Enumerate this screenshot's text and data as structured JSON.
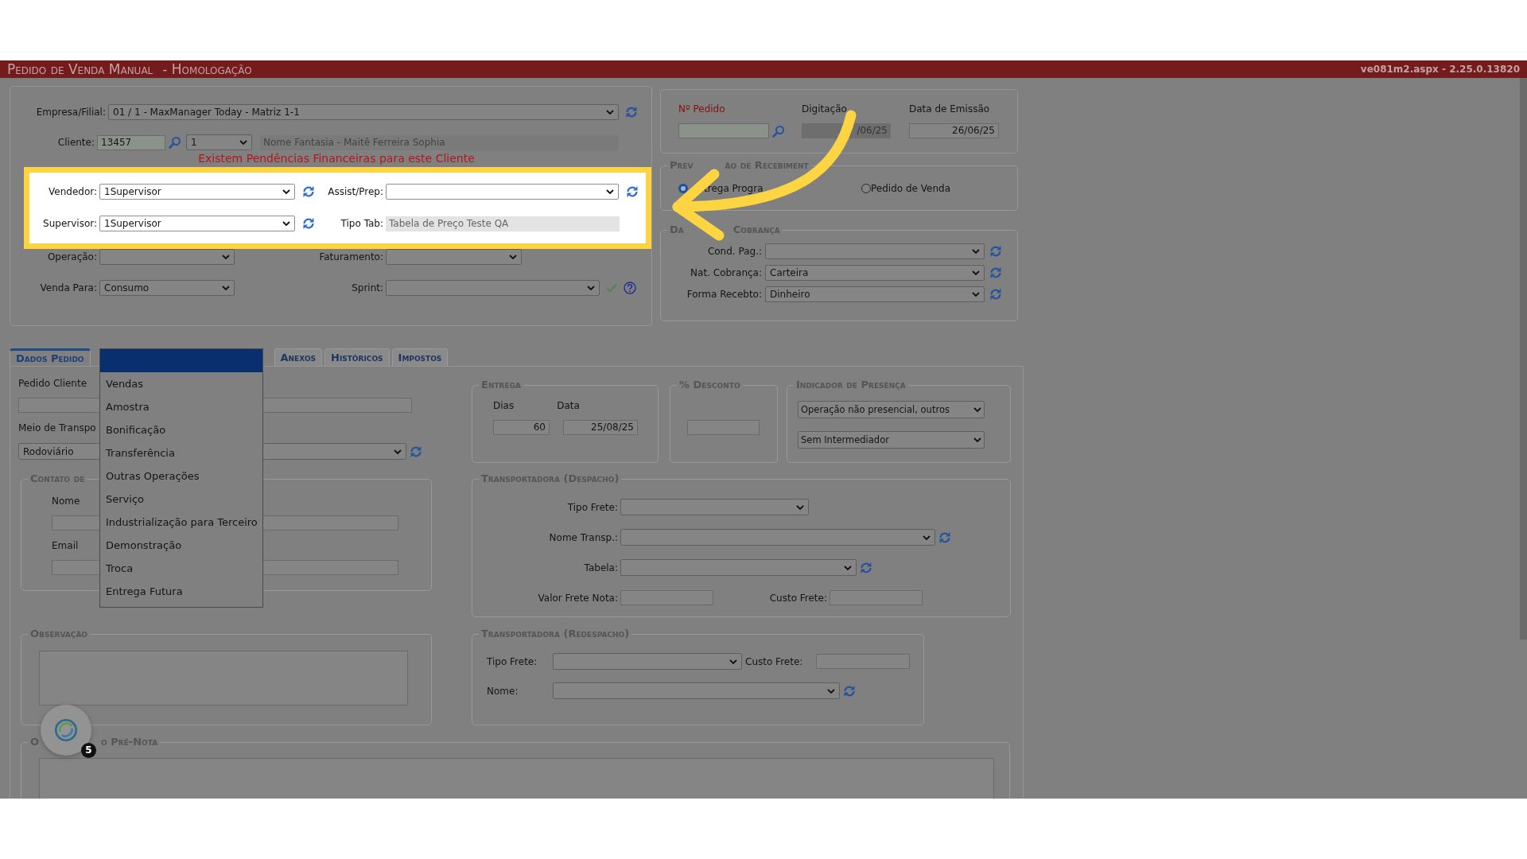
{
  "title_bar": {
    "title": "Pedido de Venda Manual",
    "subtitle": "- Homologação",
    "version": "ve081m2.aspx - 2.25.0.13820"
  },
  "header": {
    "empresa": {
      "label": "Empresa/Filial:",
      "value": "01 / 1 - MaxManager Today - Matriz 1-1"
    },
    "cliente": {
      "label": "Cliente:",
      "code": "13457",
      "store": "1",
      "name": "Nome Fantasia - Maitê Ferreira Sophia"
    },
    "alert": "Existem Pendências Financeiras para este Cliente",
    "highlighted_rows": [
      [
        {
          "kind": "select",
          "label": "Vendedor:",
          "value": "1Supervisor",
          "refresh": true
        },
        {
          "kind": "select",
          "label": "Assist/Prep:",
          "refresh": true
        }
      ],
      [
        {
          "kind": "select",
          "label": "Supervisor:",
          "value": "1Supervisor",
          "refresh": true
        },
        {
          "kind": "readonly",
          "label": "Tipo Tab:",
          "value": "Tabela de Preço Teste QA",
          "refresh": false
        }
      ]
    ],
    "rows": [
      [
        {
          "kind": "select",
          "label": "Operação:",
          "refresh": false
        },
        {
          "kind": "select",
          "label": "Faturamento:",
          "refresh": false
        }
      ],
      [
        {
          "kind": "select",
          "label": "Venda Para:",
          "value": "Consumo",
          "refresh": false
        },
        {
          "kind": "select_confirm",
          "label": "Sprint:",
          "refresh": false
        }
      ]
    ]
  },
  "order": {
    "number_label": "Nº Pedido",
    "typed_label": "Digitação",
    "typed_value": "/06/25",
    "issue_label": "Data de Emissão",
    "issue_value": "26/06/25"
  },
  "receipt": {
    "legend_parts": [
      "Prev",
      "ão de Recebiment"
    ],
    "options": [
      {
        "label": "trega Progra",
        "selected": true
      },
      {
        "label": "Pedido de Venda",
        "selected": false
      }
    ]
  },
  "billing": {
    "legend_parts": [
      "Da",
      "Cobrança"
    ],
    "fields": [
      {
        "label": "Cond. Pag.:"
      },
      {
        "label": "Nat. Cobrança:",
        "value": "Carteira"
      },
      {
        "label": "Forma Recebto:",
        "value": "Dinheiro"
      }
    ]
  },
  "tabs": [
    {
      "label": "Dados Pedido",
      "selected": true
    },
    {
      "label": "Anexos",
      "selected": false
    },
    {
      "label": "Históricos",
      "selected": false
    },
    {
      "label": "Impostos",
      "selected": false
    }
  ],
  "order_data": {
    "customer_order_label": "Pedido Cliente",
    "transport_label": "Meio de Transpo",
    "transport_value": "Rodoviário",
    "contact": {
      "legend": "Contato de",
      "name_label": "Nome",
      "email_label": "Email"
    },
    "notes": {
      "legend": "Observação"
    },
    "prenote": {
      "legend_parts": [
        "O",
        "o Pré-Nota"
      ]
    }
  },
  "delivery": {
    "legend": "Entrega",
    "days_label": "Dias",
    "date_label": "Data",
    "days": "60",
    "date": "25/08/25"
  },
  "discount": {
    "legend": "% Desconto"
  },
  "presence": {
    "legend": "Indicador de Presença",
    "values": [
      "Operação não presencial, outros",
      "Sem Intermediador"
    ]
  },
  "dispatch": {
    "legend": "Transportadora (Despacho)",
    "freight_type_label": "Tipo Frete:",
    "carrier_label": "Nome Transp.:",
    "table_label": "Tabela:",
    "freight_value_label": "Valor Frete Nota:",
    "freight_cost_label": "Custo Frete:"
  },
  "redispatch": {
    "legend": "Transportadora (Redespacho)",
    "freight_type_label": "Tipo Frete:",
    "freight_cost_label": "Custo Frete:",
    "name_label": "Nome:"
  },
  "dropdown": {
    "blank_selected": true,
    "options": [
      "Vendas",
      "Amostra",
      "Bonificação",
      "Transferência",
      "Outras Operações",
      "Serviço",
      "Industrialização para Terceiro",
      "Demonstração",
      "Troca",
      "Entrega Futura"
    ]
  },
  "chat": {
    "badge": "5"
  }
}
